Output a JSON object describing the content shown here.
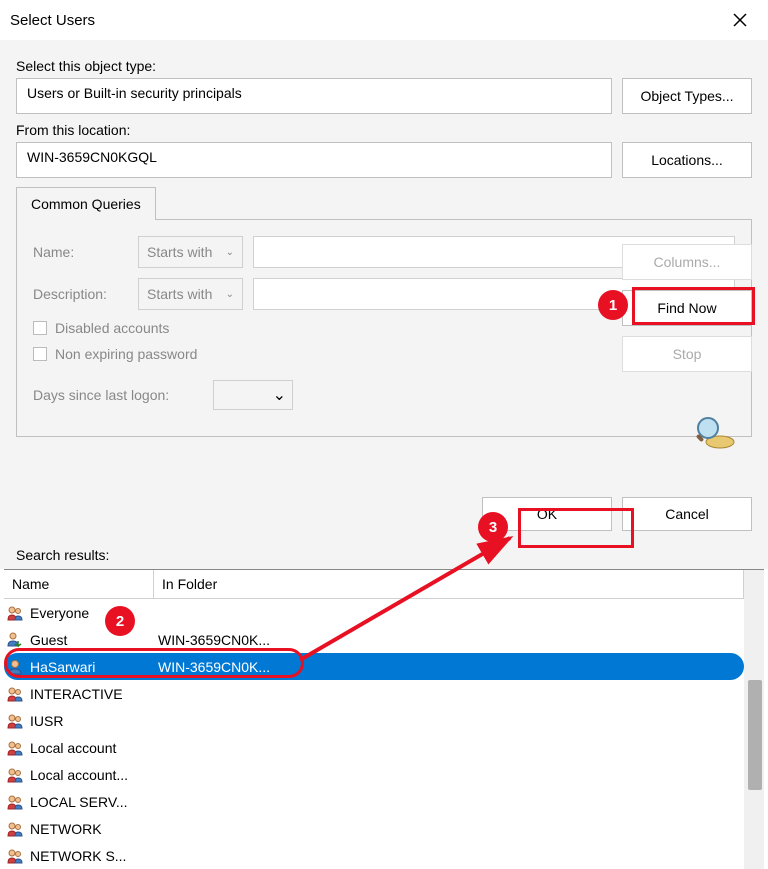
{
  "title": "Select Users",
  "objectTypeLabel": "Select this object type:",
  "objectTypeValue": "Users or Built-in security principals",
  "objectTypesBtn": "Object Types...",
  "locationLabel": "From this location:",
  "locationValue": "WIN-3659CN0KGQL",
  "locationsBtn": "Locations...",
  "tabLabel": "Common Queries",
  "nameLabel": "Name:",
  "descLabel": "Description:",
  "startsWith": "Starts with",
  "disabledChk": "Disabled accounts",
  "nonExpChk": "Non expiring password",
  "daysLabel": "Days since last logon:",
  "columnsBtn": "Columns...",
  "findNowBtn": "Find Now",
  "stopBtn": "Stop",
  "okBtn": "OK",
  "cancelBtn": "Cancel",
  "searchResultsLabel": "Search results:",
  "colName": "Name",
  "colFolder": "In Folder",
  "results": [
    {
      "name": "Everyone",
      "folder": "",
      "type": "group"
    },
    {
      "name": "Guest",
      "folder": "WIN-3659CN0K...",
      "type": "userdown"
    },
    {
      "name": "HaSarwari",
      "folder": "WIN-3659CN0K...",
      "type": "user",
      "selected": true
    },
    {
      "name": "INTERACTIVE",
      "folder": "",
      "type": "group"
    },
    {
      "name": "IUSR",
      "folder": "",
      "type": "group"
    },
    {
      "name": "Local account",
      "folder": "",
      "type": "group"
    },
    {
      "name": "Local account...",
      "folder": "",
      "type": "group"
    },
    {
      "name": "LOCAL SERV...",
      "folder": "",
      "type": "group"
    },
    {
      "name": "NETWORK",
      "folder": "",
      "type": "group"
    },
    {
      "name": "NETWORK S...",
      "folder": "",
      "type": "group"
    }
  ],
  "annotations": {
    "n1": "1",
    "n2": "2",
    "n3": "3"
  }
}
